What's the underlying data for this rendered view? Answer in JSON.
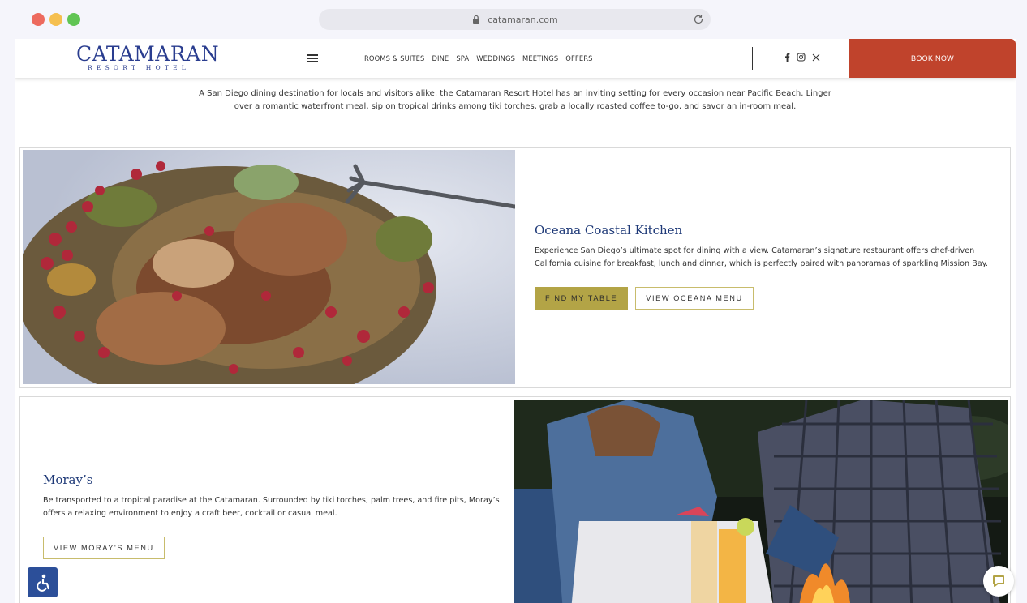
{
  "browser": {
    "url": "catamaran.com"
  },
  "header": {
    "logo_main": "CATAMARAN",
    "logo_sub": "RESORT HOTEL",
    "nav_links": [
      "ROOMS & SUITES",
      "DINE",
      "SPA",
      "WEDDINGS",
      "MEETINGS",
      "OFFERS"
    ],
    "social_icons": [
      "facebook-icon",
      "instagram-icon",
      "x-icon"
    ],
    "book_label": "BOOK NOW",
    "book_color": "#c0432c"
  },
  "intro_text": "A San Diego dining destination for locals and visitors alike, the Catamaran Resort Hotel has an inviting setting for every occasion near Pacific Beach. Linger over a romantic waterfront meal, sip on tropical drinks among tiki torches, grab a locally roasted coffee to-go, and savor an in-room meal.",
  "restaurants": [
    {
      "name": "Oceana Coastal Kitchen",
      "description": "Experience San Diego’s ultimate spot for dining with a view. Catamaran’s signature restaurant offers chef-driven California cuisine for breakfast, lunch and dinner, which is perfectly paired with panoramas of sparkling Mission Bay.",
      "primary_button": "FIND MY TABLE",
      "secondary_button": "VIEW OCEANA MENU"
    },
    {
      "name": "Moray’s",
      "description": "Be transported to a tropical paradise at the Catamaran. Surrounded by tiki torches, palm trees, and fire pits, Moray’s offers a relaxing environment to enjoy a craft beer, cocktail or casual meal.",
      "secondary_button": "VIEW MORAY'S MENU"
    }
  ],
  "colors": {
    "brand_blue": "#2a3d8f",
    "button_gold": "#b3a446",
    "accessibility_blue": "#2c4f99"
  }
}
